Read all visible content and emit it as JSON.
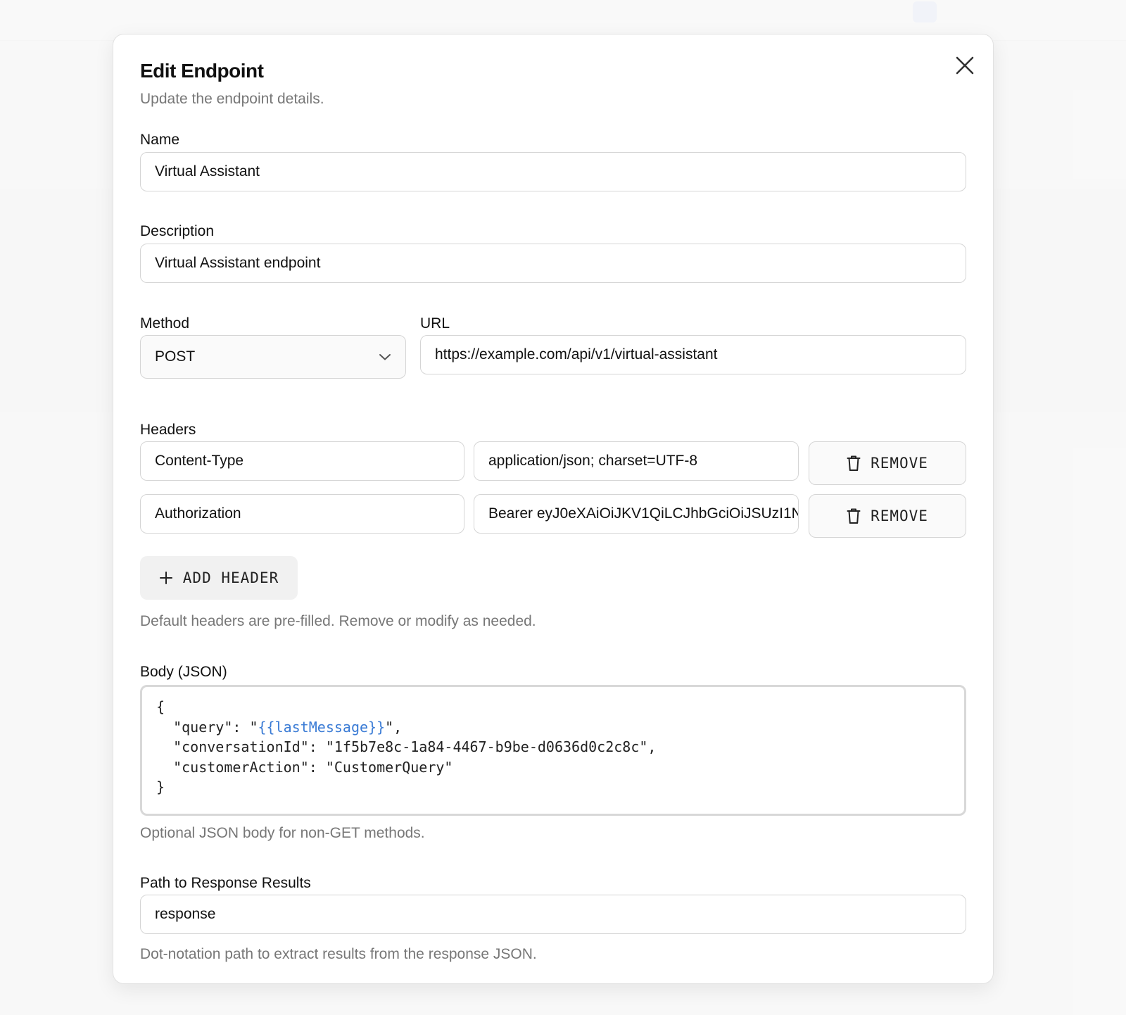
{
  "dialog": {
    "title": "Edit Endpoint",
    "subtitle": "Update the endpoint details.",
    "close_icon": "close-icon"
  },
  "form": {
    "name": {
      "label": "Name",
      "value": "Virtual Assistant"
    },
    "description": {
      "label": "Description",
      "value": "Virtual Assistant endpoint"
    },
    "method": {
      "label": "Method",
      "value": "POST"
    },
    "url": {
      "label": "URL",
      "value": "https://example.com/api/v1/virtual-assistant"
    },
    "headers": {
      "label": "Headers",
      "rows": [
        {
          "key": "Content-Type",
          "value": "application/json; charset=UTF-8",
          "remove_label": "REMOVE"
        },
        {
          "key": "Authorization",
          "value": "Bearer eyJ0eXAiOiJKV1QiLCJhbGciOiJSUzI1N",
          "remove_label": "REMOVE"
        }
      ],
      "add_label": "ADD HEADER",
      "hint": "Default headers are pre-filled. Remove or modify as needed."
    },
    "body": {
      "label": "Body (JSON)",
      "open_brace": "{",
      "close_brace": "}",
      "lines": [
        {
          "key": "\"query\": ",
          "pre": "\"",
          "template": "{{lastMessage}}",
          "post": "\","
        },
        {
          "key": "\"conversationId\": ",
          "value": "\"1f5b7e8c-1a84-4467-b9be-d0636d0c2c8c\","
        },
        {
          "key": "\"customerAction\": ",
          "value": "\"CustomerQuery\""
        }
      ],
      "hint": "Optional JSON body for non-GET methods."
    },
    "response_path": {
      "label": "Path to Response Results",
      "value": "response",
      "hint": "Dot-notation path to extract results from the response JSON."
    }
  }
}
